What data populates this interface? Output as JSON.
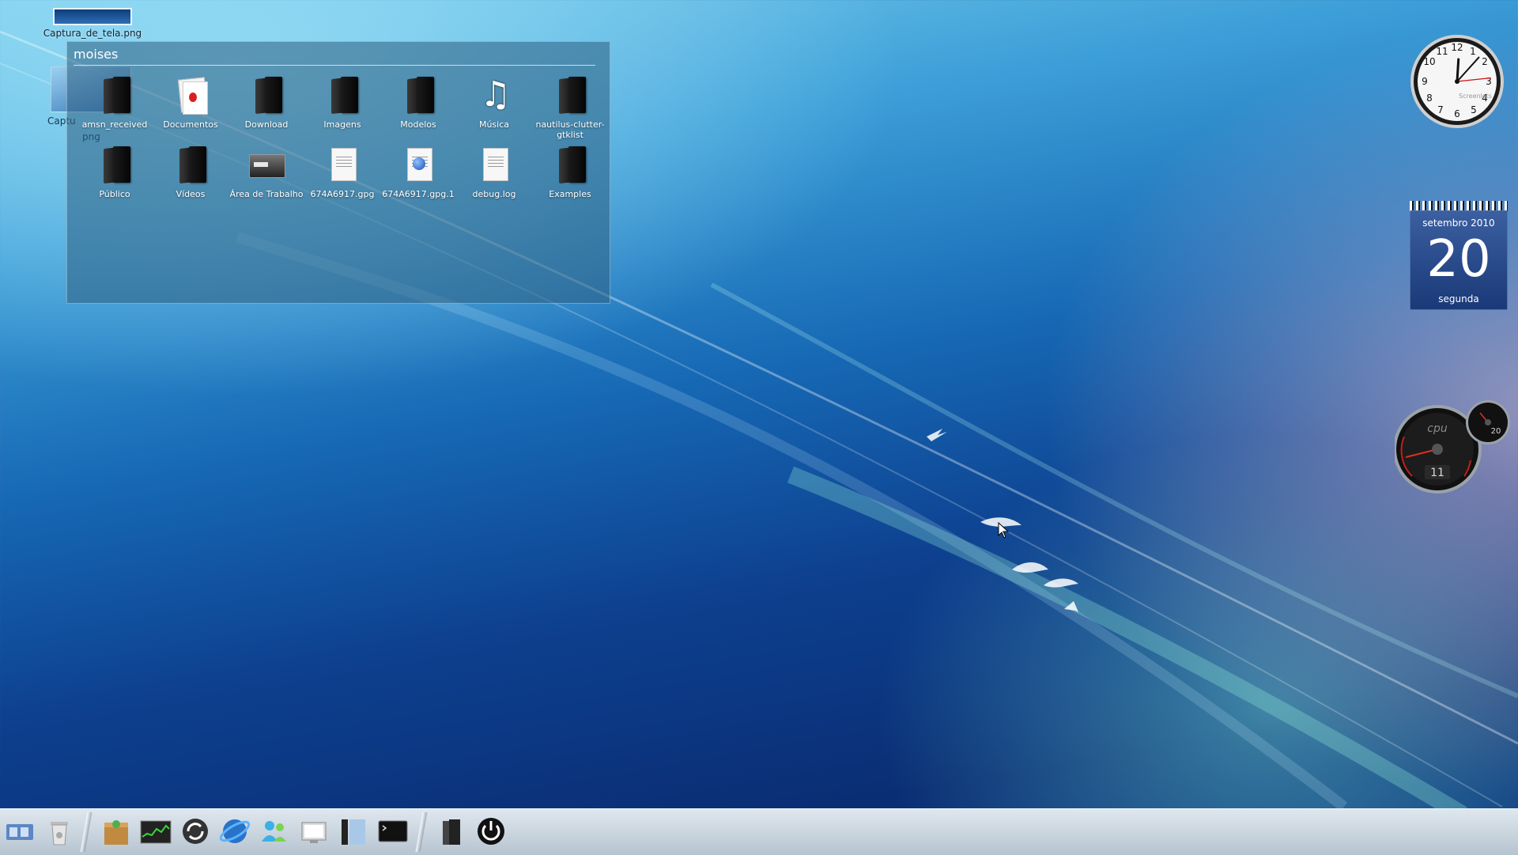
{
  "desktop": {
    "icon_top_label": "Captura_de_tela.png",
    "ghost_label_1": "Captu",
    "ghost_label_2": "png"
  },
  "folder_view": {
    "title": "moises",
    "items": [
      {
        "label": "amsn_received",
        "icon": "folder-icon"
      },
      {
        "label": "Documentos",
        "icon": "documents-icon"
      },
      {
        "label": "Download",
        "icon": "folder-icon"
      },
      {
        "label": "Imagens",
        "icon": "folder-icon"
      },
      {
        "label": "Modelos",
        "icon": "folder-icon"
      },
      {
        "label": "Música",
        "icon": "music-icon"
      },
      {
        "label": "nautilus-clutter-gtklist",
        "icon": "folder-icon"
      },
      {
        "label": "Público",
        "icon": "folder-icon"
      },
      {
        "label": "Vídeos",
        "icon": "folder-icon"
      },
      {
        "label": "Área de Trabalho",
        "icon": "desktop-icon"
      },
      {
        "label": "674A6917.gpg",
        "icon": "text-file-icon"
      },
      {
        "label": "674A6917.gpg.1",
        "icon": "web-file-icon"
      },
      {
        "label": "debug.log",
        "icon": "text-file-icon"
      },
      {
        "label": "Examples",
        "icon": "folder-icon"
      }
    ]
  },
  "widgets": {
    "clock": {
      "brand": "Screenlets",
      "hour": 12,
      "minute": 7,
      "second": 14
    },
    "calendar": {
      "month": "setembro 2010",
      "day": "20",
      "weekday": "segunda"
    },
    "cpu": {
      "label": "cpu",
      "value": "11",
      "sub_value": "20"
    }
  },
  "dock": {
    "items": [
      "home-folder-icon",
      "trash-icon",
      "package-icon",
      "system-monitor-icon",
      "update-icon",
      "browser-icon",
      "messenger-icon",
      "display-icon",
      "file-manager-icon",
      "terminal-icon",
      "folder-icon",
      "power-icon"
    ]
  },
  "colors": {
    "accent": "#1668b4",
    "panel": "#2d5f82"
  }
}
